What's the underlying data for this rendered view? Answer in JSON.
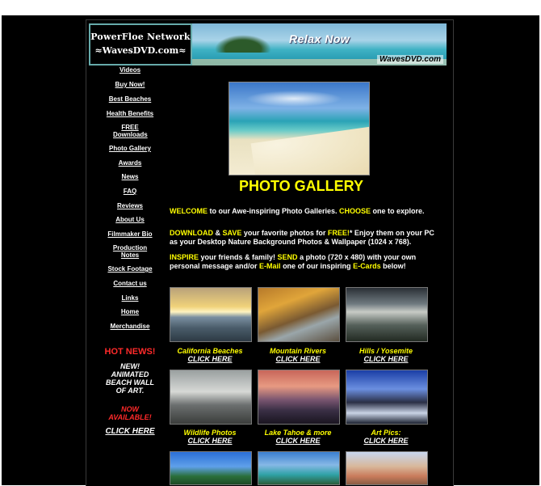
{
  "header": {
    "logo_line1": "PowerFloe Network",
    "logo_line2": "≈WavesDVD.com≈",
    "banner_tagline": "Relax Now",
    "banner_site": "WavesDVD.com"
  },
  "nav": {
    "items": [
      "Videos",
      "Buy Now!",
      "Best Beaches",
      "Health Benefits",
      "FREE Downloads",
      "Photo Gallery",
      "Awards",
      "News",
      "FAQ",
      "Reviews",
      "About Us",
      "Filmmaker Bio",
      "Production Notes",
      "Stock Footage",
      "Contact us",
      "Links",
      "Home",
      "Merchandise"
    ]
  },
  "promo": {
    "hot_news": "HOT NEWS!",
    "line1": "NEW!",
    "line2": "ANIMATED",
    "line3": "BEACH WALL",
    "line4": "OF ART.",
    "now": "NOW",
    "available": "AVAILABLE!",
    "click": "CLICK HERE"
  },
  "main": {
    "title": "PHOTO GALLERY",
    "intro": {
      "w1": "WELCOME",
      "t1": " to our Awe-inspiring Photo Galleries. ",
      "w2": "CHOOSE",
      "t2": " one to explore."
    },
    "download": {
      "w1": "DOWNLOAD",
      "t1": " & ",
      "w2": "SAVE",
      "t2": " your favorite photos for ",
      "w3": "FREE!",
      "t3": "* Enjoy them on your PC as your Desktop Nature Background Photos & Wallpaper (1024 x 768)."
    },
    "inspire": {
      "w1": "INSPIRE",
      "t1": " your friends & family! ",
      "w2": "SEND",
      "t2": " a photo (720 x 480) with your own personal message and/or ",
      "w3": "E-Mail",
      "t3": " one of our inspiring ",
      "w4": "E-Cards",
      "t4": " below!"
    },
    "galleries": [
      {
        "name": "California Beaches",
        "link": "CLICK HERE"
      },
      {
        "name": "Mountain Rivers",
        "link": "CLICK HERE"
      },
      {
        "name": "Hills / Yosemite",
        "link": "CLICK HERE"
      },
      {
        "name": "Wildlife Photos",
        "link": "CLICK HERE"
      },
      {
        "name": "Lake Tahoe & more",
        "link": "CLICK HERE"
      },
      {
        "name": "Art Pics:",
        "link": "CLICK HERE"
      }
    ]
  }
}
